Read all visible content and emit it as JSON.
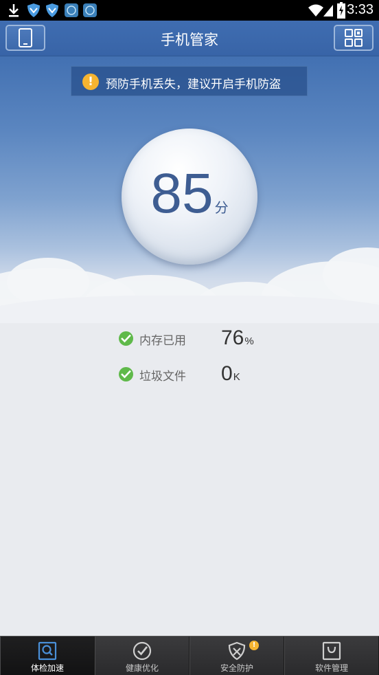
{
  "status_bar": {
    "time": "3:33",
    "left_icons": [
      "download-icon",
      "shield-icon",
      "shield-icon",
      "app-icon",
      "app-icon"
    ],
    "right_icons": [
      "wifi-icon",
      "signal-icon",
      "battery-icon"
    ]
  },
  "header": {
    "title": "手机管家",
    "left_button_icon": "phone-icon",
    "right_button_icon": "grid-icon"
  },
  "banner": {
    "icon": "!",
    "text": "预防手机丢失，建议开启手机防盗"
  },
  "score": {
    "value": "85",
    "unit": "分"
  },
  "stats": [
    {
      "label": "内存已用",
      "value": "76",
      "unit": "%"
    },
    {
      "label": "垃圾文件",
      "value": "0",
      "unit": "K"
    }
  ],
  "nav": {
    "items": [
      {
        "label": "体检加速",
        "icon": "search-icon",
        "active": true
      },
      {
        "label": "健康优化",
        "icon": "check-circle-icon",
        "active": false
      },
      {
        "label": "安全防护",
        "icon": "shield-x-icon",
        "active": false,
        "badge": "!"
      },
      {
        "label": "软件管理",
        "icon": "bag-icon",
        "active": false
      }
    ]
  },
  "colors": {
    "header_blue": "#3864a7",
    "score_text": "#3e5d92",
    "check_green": "#5fb94a",
    "warning_orange": "#f5b431",
    "active_nav_icon": "#4a90d9"
  }
}
